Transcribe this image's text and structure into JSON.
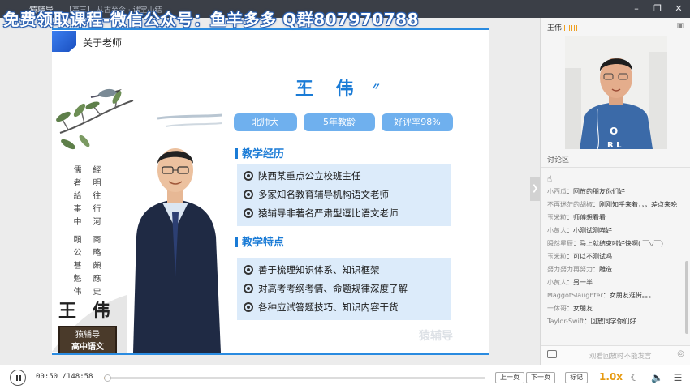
{
  "window": {
    "app_name": "猿辅导",
    "lesson_title": "【高三】 从古至今 · 课堂小结",
    "watermark": "免费领取课程-微信公众号：鱼羊多多 Q群807970788",
    "controls": [
      "minimize",
      "restore",
      "close"
    ]
  },
  "slide": {
    "heading": "关于老师",
    "teacher_name": "王 伟",
    "name_deco_left": "〃",
    "name_deco_right": "〃",
    "tags": [
      "北师大",
      "5年教龄",
      "好评率98%"
    ],
    "poem_col1": "儒者給事中",
    "poem_col2": "經明往行河",
    "poem_col3": "頤公甚魁伟",
    "poem_col4": "商略頗應史",
    "painting_name": "王 伟",
    "seal_line1": "猿辅导",
    "seal_line2": "高中语文",
    "section1": {
      "title": "教学经历",
      "items": [
        "陕西某重点公立校班主任",
        "多家知名教育辅导机构语文老师",
        "猿辅导非著名严肃型逗比语文老师"
      ]
    },
    "section2": {
      "title": "教学特点",
      "items": [
        "善于梳理知识体系、知识框架",
        "对高考考纲考情、命题规律深度了解",
        "各种应试答题技巧、知识内容干货"
      ]
    },
    "brand_watermark": "猿辅导"
  },
  "panel": {
    "teacher_label": "王伟",
    "discussion_label": "讨论区",
    "messages": [
      {
        "user": "小西瓜",
        "text": "回放的朋友你们好"
      },
      {
        "user": "不再迷茫的胡椒",
        "text": "刚刚知乎来着，，，差点来晚"
      },
      {
        "user": "玉米粒",
        "text": "师傅想看看"
      },
      {
        "user": "小黄人",
        "text": "小测试测喵好"
      },
      {
        "user": "瞬然星辰",
        "text": "马上就结束啦好快啊( ￣▽￣)"
      },
      {
        "user": "玉米粒",
        "text": "可以不测试吗"
      },
      {
        "user": "努力努力再努力",
        "text": "雕造"
      },
      {
        "user": "小黄人",
        "text": "另一半"
      },
      {
        "user": "MaggotSlaughter",
        "text": "女朋友逛街。。。"
      },
      {
        "user": "一休哥",
        "text": "女朋友"
      },
      {
        "user": "Taylor-Swift",
        "text": "回放同学你们好"
      }
    ],
    "input_placeholder": "观看回放时不能发言"
  },
  "player": {
    "current_time": "00:50",
    "total_time": "148:58",
    "progress": 0.006,
    "prev_label": "上一页",
    "next_label": "下一页",
    "mark_label": "标记",
    "speed": "1.0x"
  }
}
